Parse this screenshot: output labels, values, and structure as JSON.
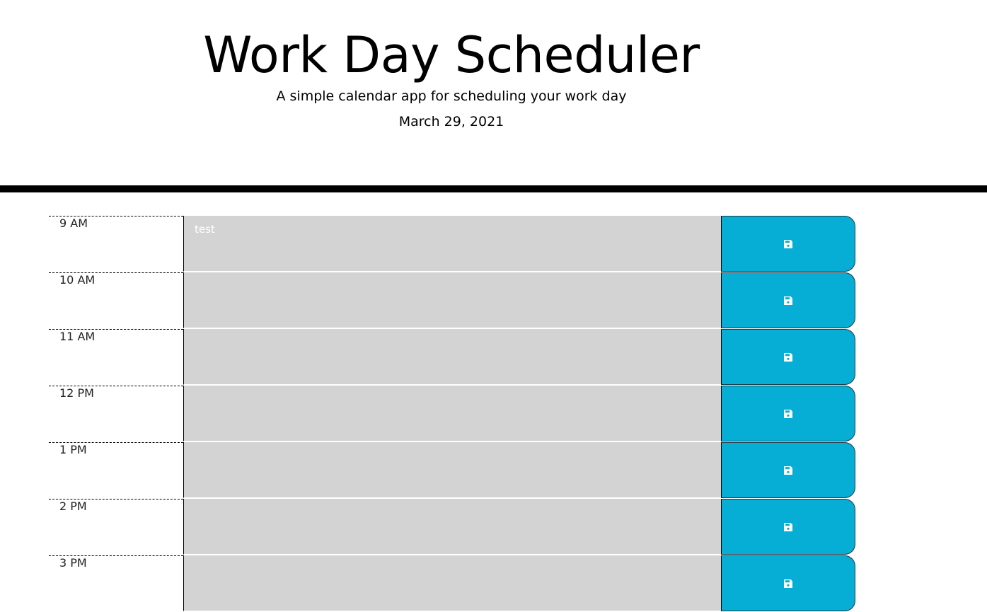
{
  "header": {
    "title": "Work Day Scheduler",
    "subtitle": "A simple calendar app for scheduling your work day",
    "current_day": "March 29, 2021"
  },
  "colors": {
    "save_button": "#06aed5",
    "past_block": "#d3d3d3",
    "divider": "#000000"
  },
  "time_blocks": [
    {
      "hour": "9 AM",
      "text": "test",
      "save_icon": "floppy-disk-icon"
    },
    {
      "hour": "10 AM",
      "text": "",
      "save_icon": "floppy-disk-icon"
    },
    {
      "hour": "11 AM",
      "text": "",
      "save_icon": "floppy-disk-icon"
    },
    {
      "hour": "12 PM",
      "text": "",
      "save_icon": "floppy-disk-icon"
    },
    {
      "hour": "1 PM",
      "text": "",
      "save_icon": "floppy-disk-icon"
    },
    {
      "hour": "2 PM",
      "text": "",
      "save_icon": "floppy-disk-icon"
    },
    {
      "hour": "3 PM",
      "text": "",
      "save_icon": "floppy-disk-icon"
    }
  ]
}
